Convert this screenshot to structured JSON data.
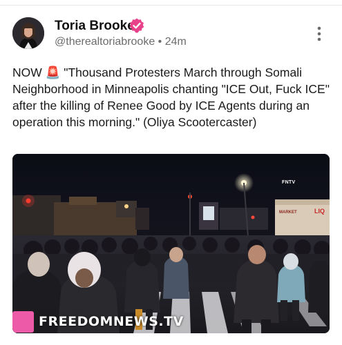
{
  "post": {
    "author_name": "Toria Brooke",
    "handle": "@therealtoriabrooke",
    "separator": "•",
    "time_ago": "24m",
    "body_text": "NOW 🚨 \"Thousand Protesters March through Somali Neighborhood in Minneapolis chanting \"ICE Out, Fuck ICE\" after the killing of Renee Good by ICE Agents during an operation this morning.\" (Oliya Scootercaster)",
    "icons": {
      "verified": "verified-badge-icon",
      "more": "more-vertical-icon"
    },
    "colors": {
      "verified_badge": "#e8428a",
      "watermark_square": "#ec5aa8"
    }
  },
  "media": {
    "watermark_top": "FNTV",
    "watermark_bottom": "FREEDOMNEWS.TV",
    "signs": {
      "liquor_sign": "LIQ",
      "store_sign": "MARKET"
    }
  }
}
